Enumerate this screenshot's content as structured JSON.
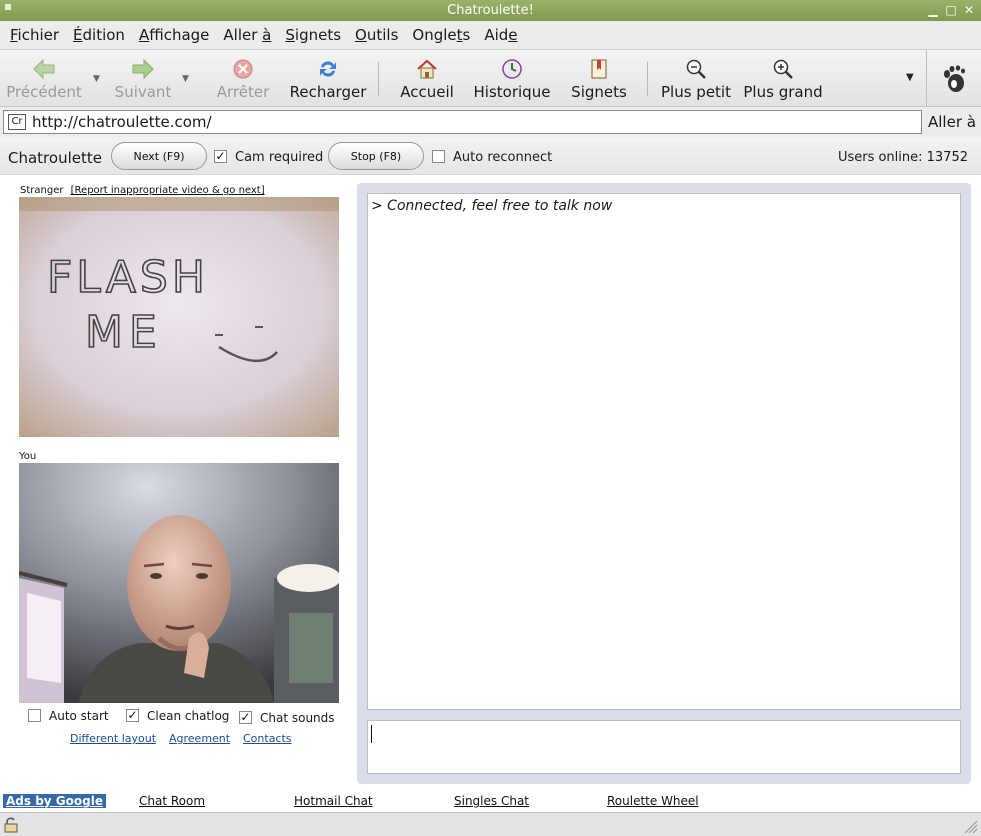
{
  "window": {
    "title": "Chatroulette!"
  },
  "menu": {
    "items": [
      {
        "pre": "",
        "u": "F",
        "post": "ichier"
      },
      {
        "pre": "",
        "u": "É",
        "post": "dition"
      },
      {
        "pre": "",
        "u": "A",
        "post": "ffichage"
      },
      {
        "pre": "Aller ",
        "u": "à",
        "post": ""
      },
      {
        "pre": "",
        "u": "S",
        "post": "ignets"
      },
      {
        "pre": "",
        "u": "O",
        "post": "utils"
      },
      {
        "pre": "Ongle",
        "u": "t",
        "post": "s"
      },
      {
        "pre": "Aid",
        "u": "e",
        "post": ""
      }
    ]
  },
  "toolbar": {
    "back": "Précédent",
    "forward": "Suivant",
    "stop": "Arrêter",
    "reload": "Recharger",
    "home": "Accueil",
    "history": "Historique",
    "bookmarks": "Signets",
    "zoom_out": "Plus petit",
    "zoom_in": "Plus grand"
  },
  "address": {
    "url": "http://chatroulette.com/",
    "favicon": "Cr",
    "go": "Aller à"
  },
  "site": {
    "title": "Chatroulette",
    "next_button": "Next (F9)",
    "cam_required": "Cam required",
    "cam_required_checked": true,
    "stop_button": "Stop (F8)",
    "auto_reconnect": "Auto reconnect",
    "auto_reconnect_checked": false,
    "users_online": "Users online: 13752"
  },
  "stranger": {
    "label": "Stranger",
    "report_link": "[Report inappropriate video & go next]",
    "sign_line1": "FLASH",
    "sign_line2": "ME"
  },
  "you": {
    "label": "You"
  },
  "options": {
    "auto_start": "Auto start",
    "auto_start_checked": false,
    "clean_chatlog": "Clean chatlog",
    "clean_chatlog_checked": true,
    "chat_sounds": "Chat sounds",
    "chat_sounds_checked": true
  },
  "links": {
    "different_layout": "Different layout",
    "agreement": "Agreement",
    "contacts": "Contacts"
  },
  "chat": {
    "log": "> Connected, feel free to talk now",
    "input_value": ""
  },
  "ads": {
    "google": "Ads by Google",
    "items": [
      "Chat Room",
      "Hotmail Chat",
      "Singles Chat",
      "Roulette Wheel"
    ]
  },
  "colors": {
    "titlebar": "#8aa65a",
    "link": "#1a4f93",
    "chat_panel": "#d9dde6"
  },
  "icons": [
    "arrow-left-icon",
    "arrow-right-icon",
    "stop-icon",
    "reload-icon",
    "home-icon",
    "history-icon",
    "bookmarks-icon",
    "zoom-out-icon",
    "zoom-in-icon",
    "gnome-foot-icon",
    "lock-icon"
  ]
}
